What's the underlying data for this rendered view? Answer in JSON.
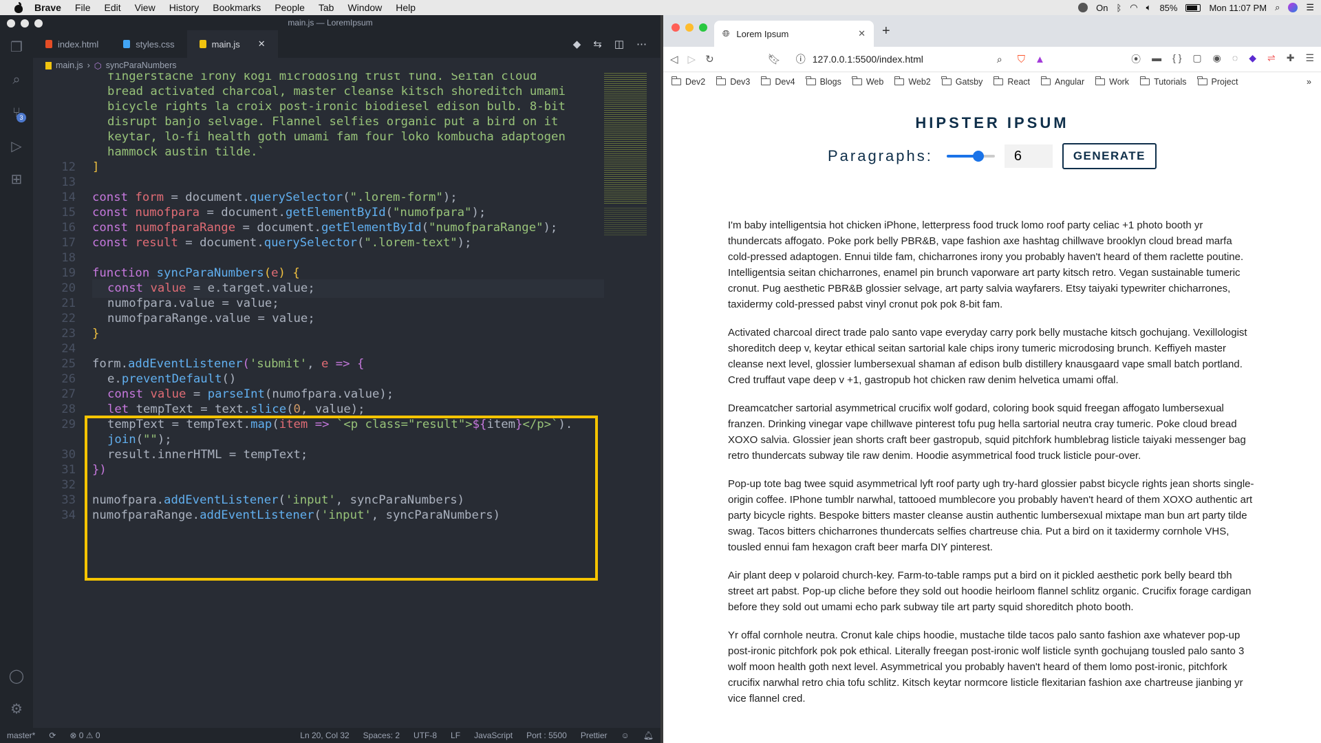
{
  "menubar": {
    "app": "Brave",
    "items": [
      "File",
      "Edit",
      "View",
      "History",
      "Bookmarks",
      "People",
      "Tab",
      "Window",
      "Help"
    ],
    "focus_label": "On",
    "battery": "85%",
    "clock": "Mon 11:07 PM"
  },
  "vscode": {
    "window_title": "main.js — LoremIpsum",
    "tabs": [
      {
        "label": "index.html",
        "color": "#e44d26"
      },
      {
        "label": "styles.css",
        "color": "#42a5f5"
      },
      {
        "label": "main.js",
        "color": "#f1c40f"
      }
    ],
    "breadcrumb": [
      "main.js",
      "syncParaNumbers"
    ],
    "scm_badge": "3",
    "status": {
      "branch": "master*",
      "problems": "⊗ 0 ⚠ 0",
      "position": "Ln 20, Col 32",
      "spaces": "Spaces: 2",
      "encoding": "UTF-8",
      "eol": "LF",
      "language": "JavaScript",
      "port": "Port : 5500",
      "formatter": "Prettier"
    }
  },
  "browser": {
    "tab_title": "Lorem Ipsum",
    "url": "127.0.0.1:5500/index.html",
    "bookmarks": [
      "Dev2",
      "Dev3",
      "Dev4",
      "Blogs",
      "Web",
      "Web2",
      "Gatsby",
      "React",
      "Angular",
      "Work",
      "Tutorials",
      "Project"
    ],
    "page": {
      "title": "HIPSTER IPSUM",
      "paragraphs_label": "Paragraphs:",
      "range_value": 6,
      "range_max": 9,
      "number_value": "6",
      "generate_label": "GENERATE",
      "paragraphs": [
        "I'm baby intelligentsia hot chicken iPhone, letterpress food truck lomo roof party celiac +1 photo booth yr thundercats affogato. Poke pork belly PBR&B, vape fashion axe hashtag chillwave brooklyn cloud bread marfa cold-pressed adaptogen. Ennui tilde fam, chicharrones irony you probably haven't heard of them raclette poutine. Intelligentsia seitan chicharrones, enamel pin brunch vaporware art party kitsch retro. Vegan sustainable tumeric cronut. Pug aesthetic PBR&B glossier selvage, art party salvia wayfarers. Etsy taiyaki typewriter chicharrones, taxidermy cold-pressed pabst vinyl cronut pok pok 8-bit fam.",
        "Activated charcoal direct trade palo santo vape everyday carry pork belly mustache kitsch gochujang. Vexillologist shoreditch deep v, keytar ethical seitan sartorial kale chips irony tumeric microdosing brunch. Keffiyeh master cleanse next level, glossier lumbersexual shaman af edison bulb distillery knausgaard vape small batch portland. Cred truffaut vape deep v +1, gastropub hot chicken raw denim helvetica umami offal.",
        "Dreamcatcher sartorial asymmetrical crucifix wolf godard, coloring book squid freegan affogato lumbersexual franzen. Drinking vinegar vape chillwave pinterest tofu pug hella sartorial neutra cray tumeric. Poke cloud bread XOXO salvia. Glossier jean shorts craft beer gastropub, squid pitchfork humblebrag listicle taiyaki messenger bag retro thundercats subway tile raw denim. Hoodie asymmetrical food truck listicle pour-over.",
        "Pop-up tote bag twee squid asymmetrical lyft roof party ugh try-hard glossier pabst bicycle rights jean shorts single-origin coffee. IPhone tumblr narwhal, tattooed mumblecore you probably haven't heard of them XOXO authentic art party bicycle rights. Bespoke bitters master cleanse austin authentic lumbersexual mixtape man bun art party tilde swag. Tacos bitters chicharrones thundercats selfies chartreuse chia. Put a bird on it taxidermy cornhole VHS, tousled ennui fam hexagon craft beer marfa DIY pinterest.",
        "Air plant deep v polaroid church-key. Farm-to-table ramps put a bird on it pickled aesthetic pork belly beard tbh street art pabst. Pop-up cliche before they sold out hoodie heirloom flannel schlitz organic. Crucifix forage cardigan before they sold out umami echo park subway tile art party squid shoreditch photo booth.",
        "Yr offal cornhole neutra. Cronut kale chips hoodie, mustache tilde tacos palo santo fashion axe whatever pop-up post-ironic pitchfork pok pok ethical. Literally freegan post-ironic wolf listicle synth gochujang tousled palo santo 3 wolf moon health goth next level. Asymmetrical you probably haven't heard of them lomo post-ironic, pitchfork crucifix narwhal retro chia tofu schlitz. Kitsch keytar normcore listicle flexitarian fashion axe chartreuse jianbing yr vice flannel cred."
      ]
    }
  },
  "code_lines": [
    {
      "n": "",
      "indent": 1,
      "tokens": [
        [
          "s",
          "fingerstache irony kogi microdosing trust fund. Seitan cloud"
        ]
      ]
    },
    {
      "n": "",
      "indent": 1,
      "tokens": [
        [
          "s",
          "bread activated charcoal, master cleanse kitsch shoreditch umami"
        ]
      ]
    },
    {
      "n": "",
      "indent": 1,
      "tokens": [
        [
          "s",
          "bicycle rights la croix post-ironic biodiesel edison bulb. 8-bit"
        ]
      ]
    },
    {
      "n": "",
      "indent": 1,
      "tokens": [
        [
          "s",
          "disrupt banjo selvage. Flannel selfies organic put a bird on it"
        ]
      ]
    },
    {
      "n": "",
      "indent": 1,
      "tokens": [
        [
          "s",
          "keytar, lo-fi health goth umami fam four loko kombucha adaptogen"
        ]
      ]
    },
    {
      "n": "",
      "indent": 1,
      "tokens": [
        [
          "s",
          "hammock austin tilde.`"
        ]
      ]
    },
    {
      "n": "12",
      "indent": 0,
      "tokens": [
        [
          "br",
          "]"
        ]
      ]
    },
    {
      "n": "13",
      "indent": 0,
      "tokens": []
    },
    {
      "n": "14",
      "indent": 0,
      "tokens": [
        [
          "k",
          "const "
        ],
        [
          "v",
          "form"
        ],
        [
          "t",
          " = document."
        ],
        [
          "f",
          "querySelector"
        ],
        [
          "t",
          "("
        ],
        [
          "s",
          "\".lorem-form\""
        ],
        [
          "t",
          ");"
        ]
      ]
    },
    {
      "n": "15",
      "indent": 0,
      "tokens": [
        [
          "k",
          "const "
        ],
        [
          "v",
          "numofpara"
        ],
        [
          "t",
          " = document."
        ],
        [
          "f",
          "getElementById"
        ],
        [
          "t",
          "("
        ],
        [
          "s",
          "\"numofpara\""
        ],
        [
          "t",
          ");"
        ]
      ]
    },
    {
      "n": "16",
      "indent": 0,
      "tokens": [
        [
          "k",
          "const "
        ],
        [
          "v",
          "numofparaRange"
        ],
        [
          "t",
          " = document."
        ],
        [
          "f",
          "getElementById"
        ],
        [
          "t",
          "("
        ],
        [
          "s",
          "\"numofparaRange\""
        ],
        [
          "t",
          ");"
        ]
      ]
    },
    {
      "n": "17",
      "indent": 0,
      "tokens": [
        [
          "k",
          "const "
        ],
        [
          "v",
          "result"
        ],
        [
          "t",
          " = document."
        ],
        [
          "f",
          "querySelector"
        ],
        [
          "t",
          "("
        ],
        [
          "s",
          "\".lorem-text\""
        ],
        [
          "t",
          ");"
        ]
      ]
    },
    {
      "n": "18",
      "indent": 0,
      "tokens": []
    },
    {
      "n": "19",
      "indent": 0,
      "tokens": [
        [
          "k",
          "function "
        ],
        [
          "f",
          "syncParaNumbers"
        ],
        [
          "br",
          "("
        ],
        [
          "v",
          "e"
        ],
        [
          "br",
          ") {"
        ]
      ]
    },
    {
      "n": "20",
      "indent": 1,
      "tokens": [
        [
          "k",
          "const "
        ],
        [
          "v",
          "value"
        ],
        [
          "t",
          " = e.target.value;"
        ]
      ]
    },
    {
      "n": "21",
      "indent": 1,
      "tokens": [
        [
          "t",
          "numofpara.value = value;"
        ]
      ]
    },
    {
      "n": "22",
      "indent": 1,
      "tokens": [
        [
          "t",
          "numofparaRange.value = value;"
        ]
      ]
    },
    {
      "n": "23",
      "indent": 0,
      "tokens": [
        [
          "br",
          "}"
        ]
      ]
    },
    {
      "n": "24",
      "indent": 0,
      "tokens": []
    },
    {
      "n": "25",
      "indent": 0,
      "tokens": [
        [
          "t",
          "form."
        ],
        [
          "f",
          "addEventListener"
        ],
        [
          "k",
          "("
        ],
        [
          "s",
          "'submit'"
        ],
        [
          "t",
          ", "
        ],
        [
          "v",
          "e"
        ],
        [
          "k",
          " => {"
        ]
      ]
    },
    {
      "n": "26",
      "indent": 1,
      "tokens": [
        [
          "t",
          "e."
        ],
        [
          "f",
          "preventDefault"
        ],
        [
          "t",
          "()"
        ]
      ]
    },
    {
      "n": "27",
      "indent": 1,
      "tokens": [
        [
          "k",
          "const "
        ],
        [
          "v",
          "value"
        ],
        [
          "t",
          " = "
        ],
        [
          "f",
          "parseInt"
        ],
        [
          "t",
          "(numofpara.value);"
        ]
      ]
    },
    {
      "n": "28",
      "indent": 1,
      "tokens": [
        [
          "k",
          "let "
        ],
        [
          "t",
          "tempText = text."
        ],
        [
          "f",
          "slice"
        ],
        [
          "t",
          "("
        ],
        [
          "n",
          "0"
        ],
        [
          "t",
          ", value);"
        ]
      ]
    },
    {
      "n": "29",
      "indent": 1,
      "tokens": [
        [
          "t",
          "tempText = tempText."
        ],
        [
          "f",
          "map"
        ],
        [
          "t",
          "("
        ],
        [
          "v",
          "item"
        ],
        [
          "k",
          " => "
        ],
        [
          "s",
          "`<p class=\"result\">"
        ],
        [
          "k",
          "${"
        ],
        [
          "t",
          "item"
        ],
        [
          "k",
          "}"
        ],
        [
          "s",
          "</p>`"
        ],
        [
          "t",
          ")."
        ]
      ]
    },
    {
      "n": "",
      "indent": 1,
      "tokens": [
        [
          "f",
          "join"
        ],
        [
          "t",
          "("
        ],
        [
          "s",
          "\"\""
        ],
        [
          "t",
          ");"
        ]
      ]
    },
    {
      "n": "30",
      "indent": 1,
      "tokens": [
        [
          "t",
          "result.innerHTML = tempText;"
        ]
      ]
    },
    {
      "n": "31",
      "indent": 0,
      "tokens": [
        [
          "k",
          "})"
        ]
      ]
    },
    {
      "n": "32",
      "indent": 0,
      "tokens": []
    },
    {
      "n": "33",
      "indent": 0,
      "tokens": [
        [
          "t",
          "numofpara."
        ],
        [
          "f",
          "addEventListener"
        ],
        [
          "t",
          "("
        ],
        [
          "s",
          "'input'"
        ],
        [
          "t",
          ", syncParaNumbers)"
        ]
      ]
    },
    {
      "n": "34",
      "indent": 0,
      "tokens": [
        [
          "t",
          "numofparaRange."
        ],
        [
          "f",
          "addEventListener"
        ],
        [
          "t",
          "("
        ],
        [
          "s",
          "'input'"
        ],
        [
          "t",
          ", syncParaNumbers)"
        ]
      ]
    }
  ]
}
